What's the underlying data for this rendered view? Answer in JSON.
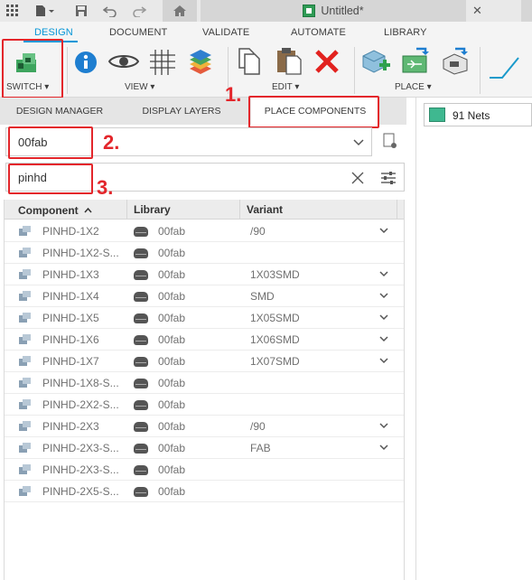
{
  "window": {
    "document_title": "Untitled*"
  },
  "ribbon_tabs": [
    "DESIGN",
    "DOCUMENT",
    "VALIDATE",
    "AUTOMATE",
    "LIBRARY"
  ],
  "ribbon_groups": {
    "switch_label": "SWITCH ▾",
    "view_label": "VIEW ▾",
    "edit_label": "EDIT ▾",
    "place_label": "PLACE ▾"
  },
  "panel_tabs": [
    "DESIGN MANAGER",
    "DISPLAY LAYERS",
    "PLACE COMPONENTS"
  ],
  "library_select": {
    "value": "00fab"
  },
  "search": {
    "value": "pinhd"
  },
  "annotations": {
    "step1": "1.",
    "step2": "2.",
    "step3": "3."
  },
  "table": {
    "headers": {
      "component": "Component",
      "library": "Library",
      "variant": "Variant"
    },
    "sort_indicator": "^",
    "rows": [
      {
        "component": "PINHD-1X2",
        "library": "00fab",
        "variant": "/90",
        "has_variants": true
      },
      {
        "component": "PINHD-1X2-S...",
        "library": "00fab",
        "variant": "",
        "has_variants": false
      },
      {
        "component": "PINHD-1X3",
        "library": "00fab",
        "variant": "1X03SMD",
        "has_variants": true
      },
      {
        "component": "PINHD-1X4",
        "library": "00fab",
        "variant": "SMD",
        "has_variants": true
      },
      {
        "component": "PINHD-1X5",
        "library": "00fab",
        "variant": "1X05SMD",
        "has_variants": true
      },
      {
        "component": "PINHD-1X6",
        "library": "00fab",
        "variant": "1X06SMD",
        "has_variants": true
      },
      {
        "component": "PINHD-1X7",
        "library": "00fab",
        "variant": "1X07SMD",
        "has_variants": true
      },
      {
        "component": "PINHD-1X8-S...",
        "library": "00fab",
        "variant": "",
        "has_variants": false
      },
      {
        "component": "PINHD-2X2-S...",
        "library": "00fab",
        "variant": "",
        "has_variants": false
      },
      {
        "component": "PINHD-2X3",
        "library": "00fab",
        "variant": "/90",
        "has_variants": true
      },
      {
        "component": "PINHD-2X3-S...",
        "library": "00fab",
        "variant": "FAB",
        "has_variants": true
      },
      {
        "component": "PINHD-2X3-S...",
        "library": "00fab",
        "variant": "",
        "has_variants": false
      },
      {
        "component": "PINHD-2X5-S...",
        "library": "00fab",
        "variant": "",
        "has_variants": false
      }
    ]
  },
  "nets": {
    "label": "91 Nets",
    "color": "#3fb890"
  },
  "colors": {
    "accent": "#0696d7",
    "annotation_red": "#e3262b"
  }
}
